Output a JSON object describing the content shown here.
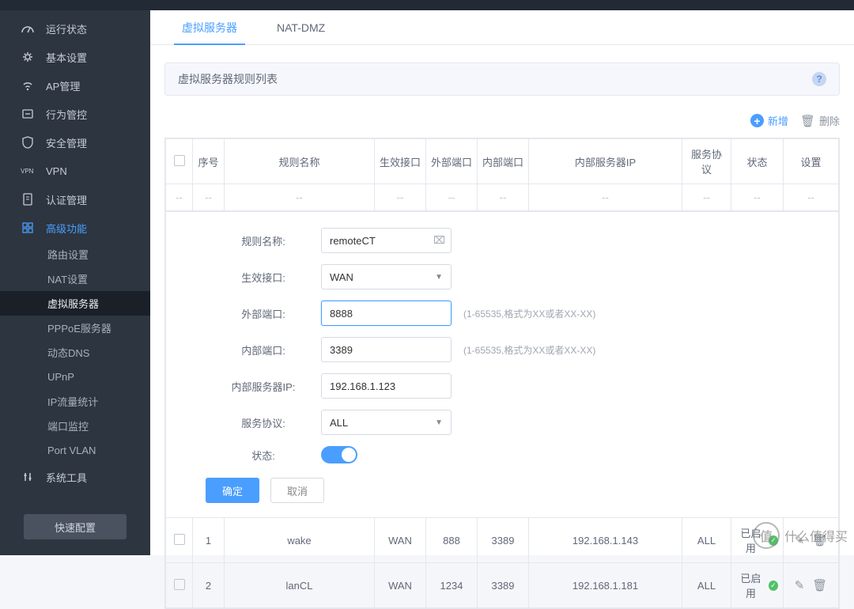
{
  "sidebar": {
    "items": [
      {
        "icon": "dashboard",
        "label": "运行状态"
      },
      {
        "icon": "gear",
        "label": "基本设置"
      },
      {
        "icon": "ap",
        "label": "AP管理"
      },
      {
        "icon": "behavior",
        "label": "行为管控"
      },
      {
        "icon": "shield",
        "label": "安全管理"
      },
      {
        "icon": "vpn",
        "label": "VPN"
      },
      {
        "icon": "auth",
        "label": "认证管理"
      },
      {
        "icon": "grid",
        "label": "高级功能"
      },
      {
        "icon": "tools",
        "label": "系统工具"
      }
    ],
    "subitems": [
      "路由设置",
      "NAT设置",
      "虚拟服务器",
      "PPPoE服务器",
      "动态DNS",
      "UPnP",
      "IP流量统计",
      "端口监控",
      "Port VLAN"
    ],
    "quick_config": "快速配置"
  },
  "tabs": [
    {
      "label": "虚拟服务器",
      "active": true
    },
    {
      "label": "NAT-DMZ",
      "active": false
    }
  ],
  "panel_title": "虚拟服务器规则列表",
  "actions": {
    "add": "新增",
    "delete": "删除"
  },
  "table": {
    "headers": [
      "序号",
      "规则名称",
      "生效接口",
      "外部端口",
      "内部端口",
      "内部服务器IP",
      "服务协议",
      "状态",
      "设置"
    ],
    "placeholder_dash": "--",
    "rows": [
      {
        "seq": "1",
        "name": "wake",
        "iface": "WAN",
        "ext": "888",
        "int": "3389",
        "ip": "192.168.1.143",
        "proto": "ALL",
        "status": "已启用"
      },
      {
        "seq": "2",
        "name": "lanCL",
        "iface": "WAN",
        "ext": "1234",
        "int": "3389",
        "ip": "192.168.1.181",
        "proto": "ALL",
        "status": "已启用"
      }
    ]
  },
  "form": {
    "rule_name_label": "规则名称:",
    "rule_name_value": "remoteCT",
    "iface_label": "生效接口:",
    "iface_value": "WAN",
    "ext_port_label": "外部端口:",
    "ext_port_value": "8888",
    "port_hint": "(1-65535,格式为XX或者XX-XX)",
    "int_port_label": "内部端口:",
    "int_port_value": "3389",
    "server_ip_label": "内部服务器IP:",
    "server_ip_value": "192.168.1.123",
    "proto_label": "服务协议:",
    "proto_value": "ALL",
    "status_label": "状态:",
    "confirm": "确定",
    "cancel": "取消"
  },
  "watermark": {
    "char": "值",
    "text": "什么值得买"
  }
}
